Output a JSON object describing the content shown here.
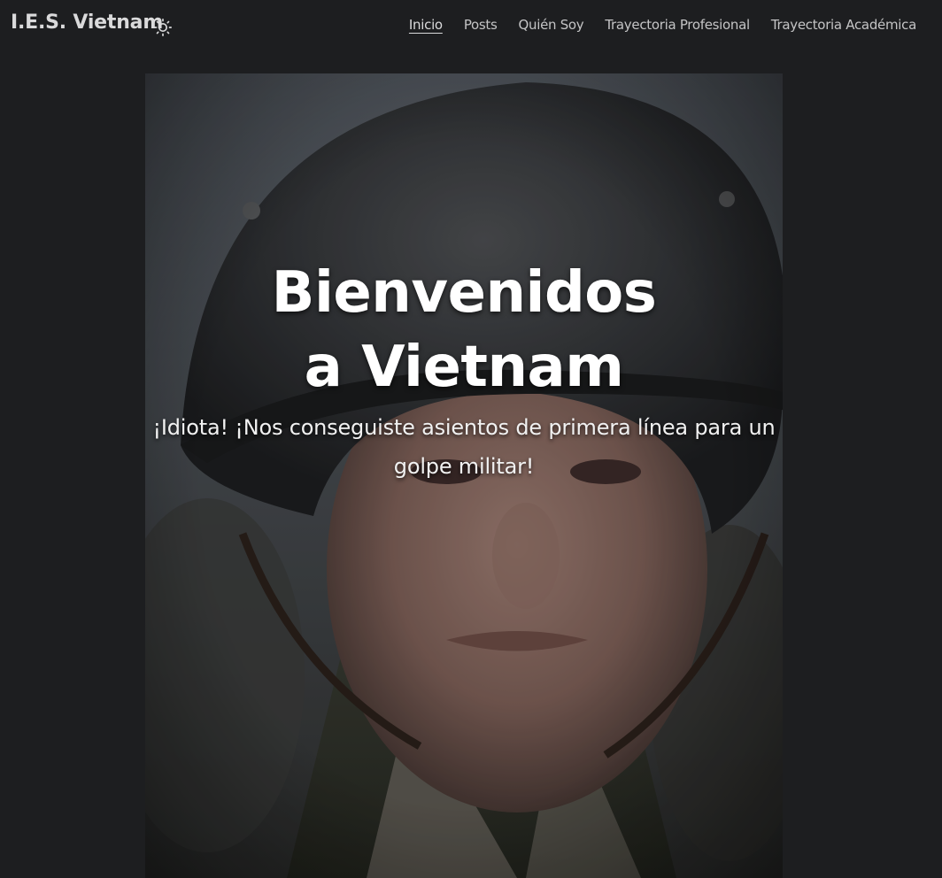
{
  "header": {
    "logo": "I.E.S. Vietnam",
    "theme_toggle_icon": "sun-icon",
    "nav": [
      {
        "label": "Inicio",
        "active": true
      },
      {
        "label": "Posts",
        "active": false
      },
      {
        "label": "Quién Soy",
        "active": false
      },
      {
        "label": "Trayectoria Profesional",
        "active": false
      },
      {
        "label": "Trayectoria Académica",
        "active": false
      }
    ]
  },
  "hero": {
    "title": "Bienvenidos a Vietnam",
    "subtitle": "¡Idiota! ¡Nos conseguiste asientos de primera línea para un golpe militar!",
    "image_subject": "portrait of a soldier wearing a steel helmet"
  },
  "colors": {
    "background": "#1d1e20",
    "text_primary": "#dadadb",
    "text_secondary": "#c4c4c5"
  }
}
